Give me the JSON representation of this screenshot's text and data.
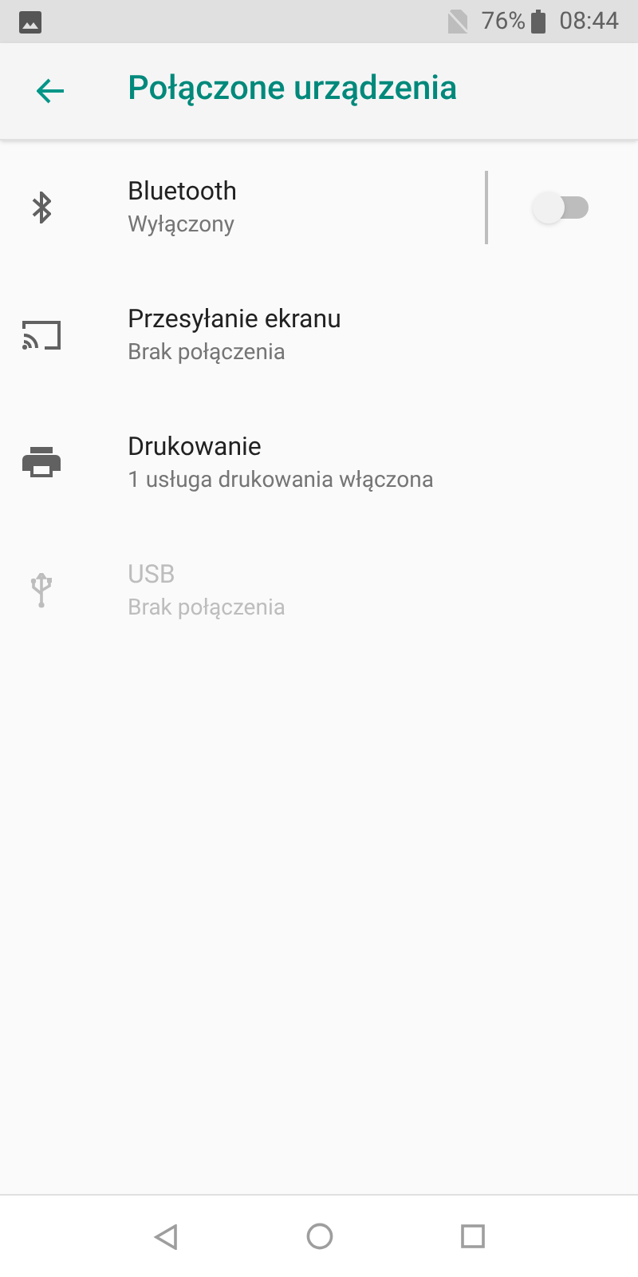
{
  "status_bar": {
    "battery": "76%",
    "time": "08:44"
  },
  "app_bar": {
    "title": "Połączone urządzenia"
  },
  "items": [
    {
      "kind": "bluetooth",
      "title": "Bluetooth",
      "summary": "Wyłączony",
      "disabled": false,
      "toggle": {
        "on": false
      }
    },
    {
      "kind": "cast",
      "title": "Przesyłanie ekranu",
      "summary": "Brak połączenia",
      "disabled": false
    },
    {
      "kind": "print",
      "title": "Drukowanie",
      "summary": "1 usługa drukowania włączona",
      "disabled": false
    },
    {
      "kind": "usb",
      "title": "USB",
      "summary": "Brak połączenia",
      "disabled": true
    }
  ]
}
